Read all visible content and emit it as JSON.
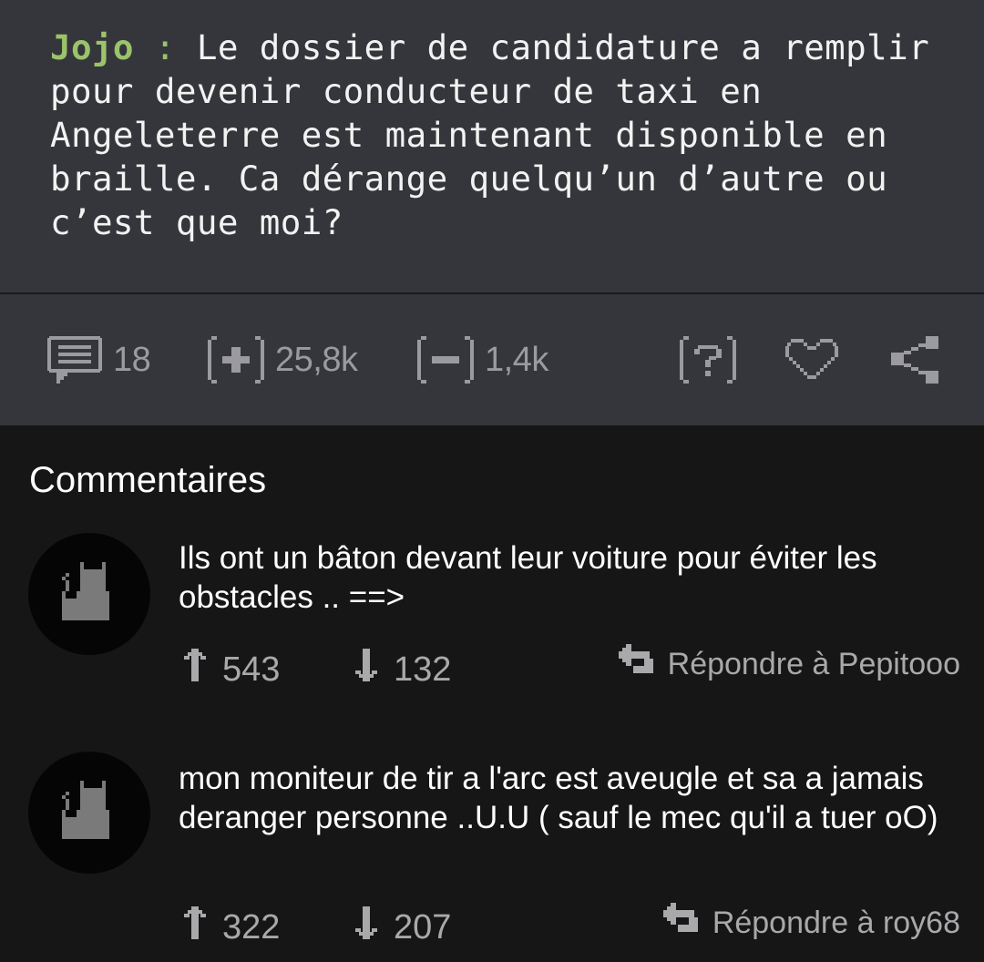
{
  "post": {
    "author": "Jojo",
    "separator": " : ",
    "text": "Le dossier de candidature a remplir\npour devenir conducteur de taxi en\nAngeleterre est maintenant disponible en\nbraille. Ca dérange quelqu’un d’autre ou\nc’est que moi?"
  },
  "actions": {
    "comments_count": "18",
    "upvotes_count": "25,8k",
    "downvotes_count": "1,4k",
    "icons": [
      "comment-icon",
      "plus-icon",
      "minus-icon",
      "help-icon",
      "heart-icon",
      "share-icon"
    ]
  },
  "comments_section": {
    "title": "Commentaires",
    "comments": [
      {
        "text": "Ils ont un bâton devant leur voiture pour éviter les obstacles .. ==>",
        "upvotes": "543",
        "downvotes": "132",
        "reply_label": "Répondre à Pepitooo"
      },
      {
        "text": "mon moniteur de tir a l'arc est aveugle et sa a jamais deranger personne ..U.U ( sauf le mec qu'il a tuer oO)",
        "upvotes": "322",
        "downvotes": "207",
        "reply_label": "Répondre à roy68"
      }
    ]
  },
  "colors": {
    "post_background": "#35363b",
    "page_background": "#161616",
    "author": "#9bc36a",
    "icon": "#9b9b9f"
  }
}
